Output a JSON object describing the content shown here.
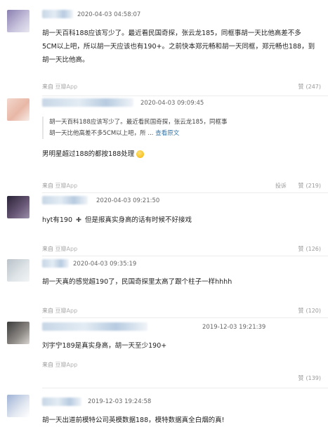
{
  "comments": [
    {
      "timestamp": "2020-04-03 04:58:07",
      "text_lines": [
        "胡一天百科188应该写少了。最近看民国奇探，张云龙185，同框事胡一天比他高差不多",
        "5CM以上吧，所以胡一天应该也有190+。之前快本郑元畅和胡一天同框，郑元畅也188，到",
        "胡一天比他高。"
      ],
      "source": "来自",
      "app": "豆瓣App",
      "report": "",
      "like_label": "赞",
      "like_count": "(247)"
    },
    {
      "timestamp": "2020-04-03 09:09:45",
      "quote_lines": [
        "胡一天百科188应该写少了。最近看民国奇探，张云龙185，同框事",
        "胡一天比他高差不多5CM以上吧，所 ..."
      ],
      "quote_more": "查看原文",
      "text": "男明星超过188的都按188处理",
      "source": "来自",
      "app": "豆瓣App",
      "report": "投诉",
      "like_label": "赞",
      "like_count": "(219)"
    },
    {
      "timestamp": "2020-04-03 09:21:50",
      "text_before": "hyt有190",
      "text_after": "但是报真实身高的话有时候不好接戏",
      "source": "来自",
      "app": "豆瓣App",
      "report": "",
      "like_label": "赞",
      "like_count": "(126)"
    },
    {
      "timestamp": "2020-04-03 09:35:19",
      "text": "胡一天真的感觉超190了，民国奇探里太高了跟个柱子一样hhhh",
      "source": "来自",
      "app": "豆瓣App",
      "report": "",
      "like_label": "赞",
      "like_count": "(120)"
    },
    {
      "timestamp": "2019-12-03 19:21:39",
      "text": "刘宇宁189是真实身高，胡一天至少190+",
      "source": "来自",
      "app": "豆瓣App",
      "report": "",
      "like_label": "赞",
      "like_count": "(139)"
    },
    {
      "timestamp": "2019-12-03 19:24:58",
      "text": "胡一天出道前模特公司英模数据188，模特数据真全白烟的真!"
    }
  ]
}
